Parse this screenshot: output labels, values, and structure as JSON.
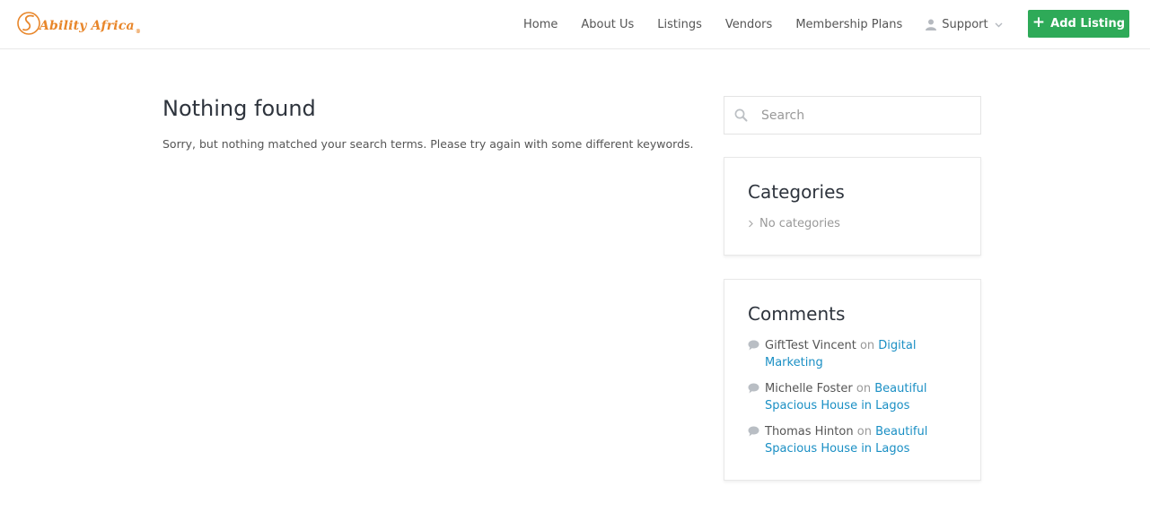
{
  "brand": {
    "name": "Ability Africa",
    "reg": "®",
    "color": "#e8862a"
  },
  "nav": {
    "items": [
      "Home",
      "About Us",
      "Listings",
      "Vendors",
      "Membership Plans"
    ],
    "support": "Support",
    "add_listing": "Add Listing"
  },
  "main": {
    "title": "Nothing found",
    "message": "Sorry, but nothing matched your search terms. Please try again with some different keywords."
  },
  "sidebar": {
    "search_placeholder": "Search",
    "categories": {
      "title": "Categories",
      "empty": "No categories"
    },
    "comments": {
      "title": "Comments",
      "on": "on",
      "items": [
        {
          "author": "GiftTest Vincent",
          "post": "Digital Marketing"
        },
        {
          "author": "Michelle Foster",
          "post": "Beautiful Spacious House in Lagos"
        },
        {
          "author": "Thomas Hinton",
          "post": "Beautiful Spacious House in Lagos"
        }
      ]
    }
  },
  "colors": {
    "accent_green": "#2eaa58",
    "link": "#1a8fc4"
  },
  "icons": [
    "logo-icon",
    "person-icon",
    "chevron-down-icon",
    "plus-icon",
    "search-icon",
    "chevron-right-icon",
    "comment-bubble-icon"
  ]
}
